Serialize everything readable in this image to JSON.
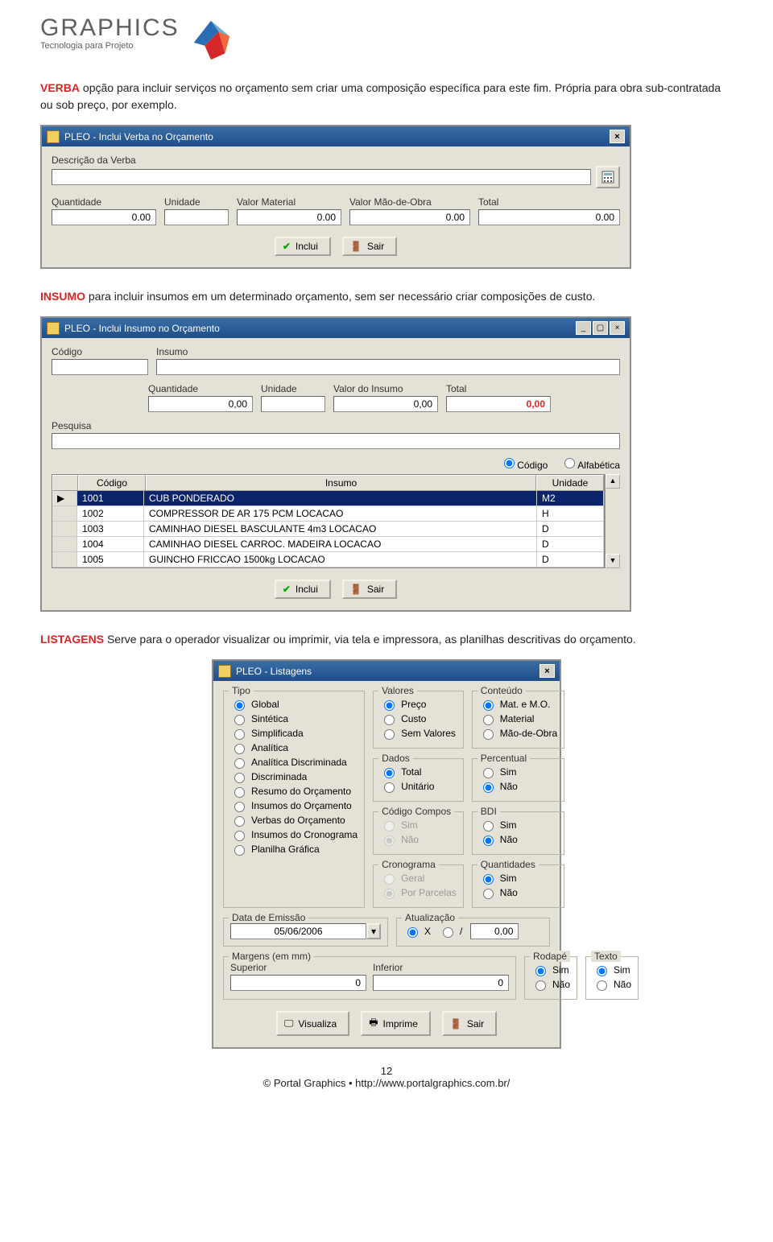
{
  "logo": {
    "title": "GRAPHICS",
    "sub": "Tecnologia para Projeto"
  },
  "para1": {
    "term": "VERBA",
    "text": " opção para incluir serviços no orçamento sem criar uma composição específica para este fim. Própria para obra sub-contratada ou sob preço, por exemplo."
  },
  "para2": {
    "term": "INSUMO",
    "text": " para incluir insumos em um determinado orçamento, sem ser necessário criar composições de custo."
  },
  "para3": {
    "term": "LISTAGENS",
    "text": " Serve para o operador visualizar ou imprimir, via tela e impressora, as planilhas descritivas do orçamento."
  },
  "dlg1": {
    "title": "PLEO - Inclui Verba no Orçamento",
    "desc_label": "Descrição da Verba",
    "desc_val": "",
    "qtd_label": "Quantidade",
    "un_label": "Unidade",
    "vm_label": "Valor Material",
    "vmo_label": "Valor Mão-de-Obra",
    "total_label": "Total",
    "qtd": "0.00",
    "un": "",
    "vm": "0.00",
    "vmo": "0.00",
    "total": "0.00",
    "btn_inclui": "Inclui",
    "btn_sair": "Sair"
  },
  "dlg2": {
    "title": "PLEO - Inclui Insumo no Orçamento",
    "cod_label": "Código",
    "ins_label": "Insumo",
    "cod_val": "",
    "ins_val": "",
    "qtd_label": "Quantidade",
    "un_label": "Unidade",
    "vi_label": "Valor do Insumo",
    "total_label": "Total",
    "qtd": "0,00",
    "un": "",
    "vi": "0,00",
    "total": "0,00",
    "pesq_label": "Pesquisa",
    "pesq_val": "",
    "radio1": "Código",
    "radio2": "Alfabética",
    "grid_headers": {
      "cod": "Código",
      "ins": "Insumo",
      "un": "Unidade"
    },
    "rows": [
      {
        "cod": "1001",
        "ins": "CUB PONDERADO",
        "un": "M2"
      },
      {
        "cod": "1002",
        "ins": "COMPRESSOR DE AR 175 PCM        LOCACAO",
        "un": "H"
      },
      {
        "cod": "1003",
        "ins": "CAMINHAO DIESEL BASCULANTE 4m3  LOCACAO",
        "un": "D"
      },
      {
        "cod": "1004",
        "ins": "CAMINHAO DIESEL CARROC. MADEIRA LOCACAO",
        "un": "D"
      },
      {
        "cod": "1005",
        "ins": "GUINCHO FRICCAO 1500kg              LOCACAO",
        "un": "D"
      }
    ],
    "btn_inclui": "Inclui",
    "btn_sair": "Sair"
  },
  "dlg3": {
    "title": "PLEO - Listagens",
    "tipo": {
      "title": "Tipo",
      "opts": [
        "Global",
        "Sintética",
        "Simplificada",
        "Analítica",
        "Analítica Discriminada",
        "Discriminada",
        "Resumo do Orçamento",
        "Insumos do Orçamento",
        "Verbas do Orçamento",
        "Insumos do Cronograma",
        "Planilha Gráfica"
      ]
    },
    "valores": {
      "title": "Valores",
      "opts": [
        "Preço",
        "Custo",
        "Sem Valores"
      ]
    },
    "dados": {
      "title": "Dados",
      "opts": [
        "Total",
        "Unitário"
      ]
    },
    "codigo": {
      "title": "Código Compos",
      "opts": [
        "Sim",
        "Não"
      ]
    },
    "crono": {
      "title": "Cronograma",
      "opts": [
        "Geral",
        "Por Parcelas"
      ]
    },
    "conteudo": {
      "title": "Conteúdo",
      "opts": [
        "Mat. e M.O.",
        "Material",
        "Mão-de-Obra"
      ]
    },
    "percent": {
      "title": "Percentual",
      "opts": [
        "Sim",
        "Não"
      ]
    },
    "bdi": {
      "title": "BDI",
      "opts": [
        "Sim",
        "Não"
      ]
    },
    "quant": {
      "title": "Quantidades",
      "opts": [
        "Sim",
        "Não"
      ]
    },
    "data_label": "Data de Emissão",
    "data_val": "05/06/2006",
    "atual": {
      "title": "Atualização",
      "x": "X",
      "slash": "/",
      "val": "0.00"
    },
    "margens": {
      "title": "Margens (em mm)",
      "sup_label": "Superior",
      "inf_label": "Inferior",
      "sup": "0",
      "inf": "0"
    },
    "rodape": {
      "title": "Rodapé",
      "opts": [
        "Sim",
        "Não"
      ]
    },
    "texto": {
      "title": "Texto",
      "opts": [
        "Sim",
        "Não"
      ]
    },
    "btn_vis": "Visualiza",
    "btn_imp": "Imprime",
    "btn_sair": "Sair"
  },
  "footer": {
    "page": "12",
    "credit": "© Portal Graphics • http://www.portalgraphics.com.br/"
  }
}
